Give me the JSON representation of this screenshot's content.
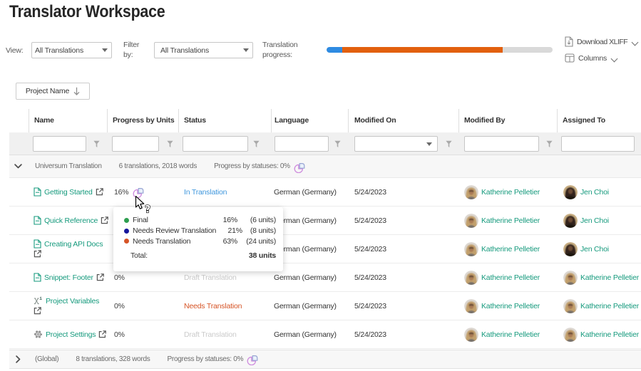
{
  "page": {
    "title": "Translator Workspace"
  },
  "toolbar": {
    "view_label": "View:",
    "view_value": "All Translations",
    "filter_label": "Filter by:",
    "filter_value": "All Translations",
    "progress_label": "Translation progress:",
    "download_label": "Download XLIFF",
    "columns_label": "Columns",
    "progress_colors": {
      "done": "#2e8be2",
      "needs": "#e2600e",
      "rest": "#d9d9d9"
    }
  },
  "grouping": {
    "chip_label": "Project Name"
  },
  "table": {
    "columns": [
      "Name",
      "Progress by Units",
      "Status",
      "Language",
      "Modified On",
      "Modified By",
      "Assigned To"
    ]
  },
  "groups": {
    "top": {
      "name": "Universum Translation",
      "summary": "6 translations, 2018 words",
      "progress": "Progress by statuses: 0%"
    },
    "bottom": {
      "name": "(Global)",
      "summary": "8 translations, 328 words",
      "progress": "Progress by statuses: 0%"
    }
  },
  "rows": [
    {
      "name": "Getting Started",
      "icon": "document",
      "progress": "16%",
      "status": "In Translation",
      "language": "German (Germany)",
      "modified_on": "5/24/2023",
      "modified_by": "Katherine Pelletier",
      "assigned_to": "Jen Choi"
    },
    {
      "name": "Quick Reference",
      "icon": "document",
      "progress": "",
      "status": "",
      "language": "German (Germany)",
      "modified_on": "5/24/2023",
      "modified_by": "Katherine Pelletier",
      "assigned_to": "Jen Choi"
    },
    {
      "name": "Creating API Docs",
      "icon": "document",
      "progress": "",
      "status": "",
      "language": "German (Germany)",
      "modified_on": "5/24/2023",
      "modified_by": "Katherine Pelletier",
      "assigned_to": "Jen Choi"
    },
    {
      "name": "Snippet: Footer",
      "icon": "document",
      "progress": "0%",
      "status": "Draft Translation",
      "language": "German (Germany)",
      "modified_on": "5/24/2023",
      "modified_by": "Katherine Pelletier",
      "assigned_to": "Katherine Pelletier"
    },
    {
      "name": "Project Variables",
      "icon": "variable",
      "progress": "0%",
      "status": "Needs Translation",
      "language": "German (Germany)",
      "modified_on": "5/24/2023",
      "modified_by": "Katherine Pelletier",
      "assigned_to": "Katherine Pelletier"
    },
    {
      "name": "Project Settings",
      "icon": "gear",
      "progress": "0%",
      "status": "Draft Translation",
      "language": "German (Germany)",
      "modified_on": "5/24/2023",
      "modified_by": "Katherine Pelletier",
      "assigned_to": "Katherine Pelletier"
    }
  ],
  "tooltip": {
    "items": [
      {
        "label": "Final",
        "pct": "16%",
        "units": "(6 units)",
        "color": "#2e9e4f"
      },
      {
        "label": "Needs Review Translation",
        "pct": "21%",
        "units": "(8 units)",
        "color": "#16169c"
      },
      {
        "label": "Needs Translation",
        "pct": "63%",
        "units": "(24 units)",
        "color": "#d65426"
      }
    ],
    "total_label": "Total:",
    "total_value": "38 units"
  }
}
